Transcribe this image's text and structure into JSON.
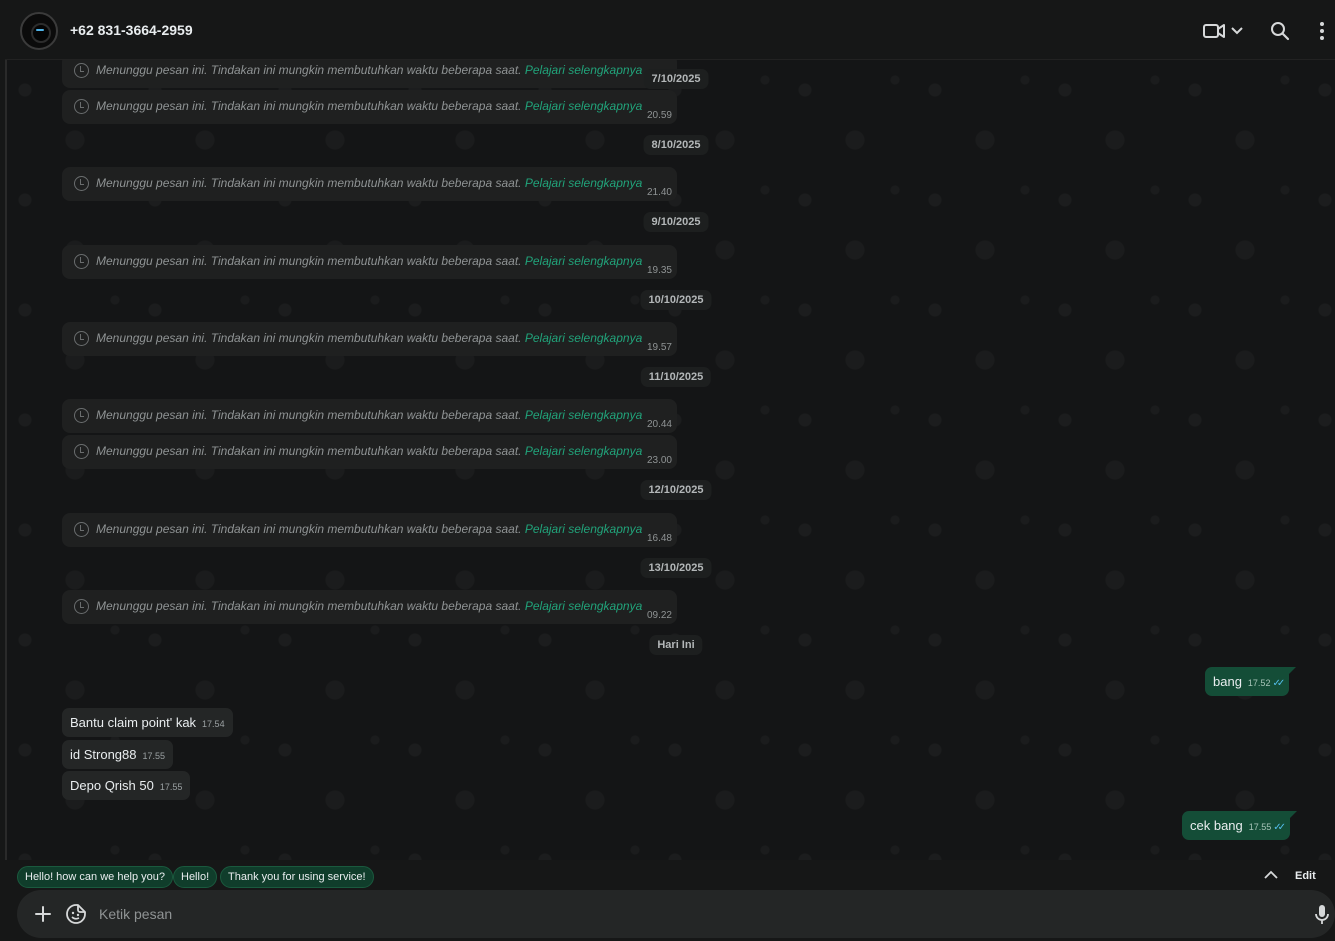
{
  "header": {
    "contact_name": "+62 831-3664-2959"
  },
  "waiting_message": {
    "text": "Menunggu pesan ini. Tindakan ini mungkin membutuhkan waktu beberapa saat.",
    "link": "Pelajari selengkapnya"
  },
  "timeline": {
    "msg0_time": "",
    "date0": "7/10/2025",
    "msg1_time": "20.59",
    "date1": "8/10/2025",
    "msg2_time": "21.40",
    "date2": "9/10/2025",
    "msg3_time": "19.35",
    "date3": "10/10/2025",
    "msg4_time": "19.57",
    "date4": "11/10/2025",
    "msg5_time": "20.44",
    "msg6_time": "23.00",
    "date5": "12/10/2025",
    "msg7_time": "16.48",
    "date6": "13/10/2025",
    "msg8_time": "09.22",
    "date7": "Hari Ini"
  },
  "messages": {
    "out1": {
      "text": "bang",
      "time": "17.52"
    },
    "in1": {
      "text": "Bantu claim point' kak",
      "time": "17.54"
    },
    "in2": {
      "text": "id Strong88",
      "time": "17.55"
    },
    "in3": {
      "text": "Depo Qrish 50",
      "time": "17.55"
    },
    "out2": {
      "text": "cek bang",
      "time": "17.55"
    }
  },
  "quick_replies": [
    "Hello! how can we help you?",
    "Hello!",
    "Thank you for using service!"
  ],
  "quick_edit_label": "Edit",
  "composer": {
    "placeholder": "Ketik pesan"
  },
  "colors": {
    "accent": "#21a37a",
    "outgoing_bubble": "#144d37",
    "incoming_bubble": "#242626",
    "read_ticks": "#53bdeb"
  }
}
